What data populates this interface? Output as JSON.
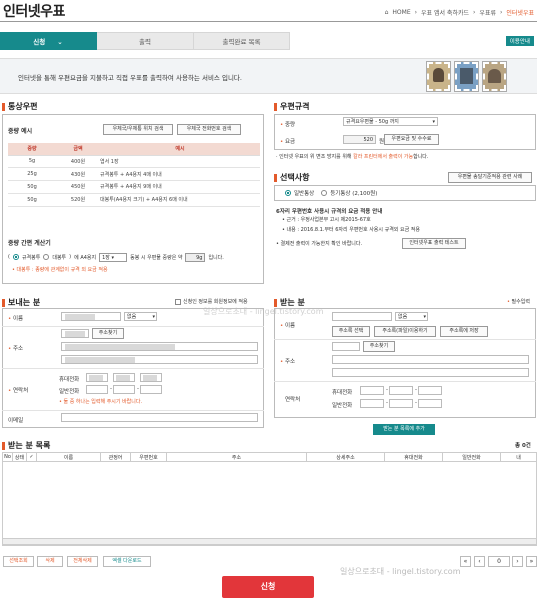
{
  "header": {
    "title": "인터넷우표",
    "breadcrumb": [
      "HOME",
      "우표 앱서 축하카드",
      "우표류",
      "인터넷우표"
    ]
  },
  "tabs": [
    {
      "label": "신청"
    },
    {
      "label": "출력"
    },
    {
      "label": "출력완료 목록"
    }
  ],
  "guide_button": "이용안내",
  "intro": "인터넷을 통해 우편요금을 지불하고 직접 우표를 출력하여 사용하는 서비스 입니다.",
  "postal": {
    "title": "통상우편",
    "example_label": "중량 예시",
    "btn_search_office": "우체국/우체통 위치 검색",
    "btn_search_zip": "우체국 전화번호 검색",
    "table": {
      "headers": [
        "중량",
        "금액",
        "예시"
      ],
      "rows": [
        {
          "weight": "5g",
          "price": "400원",
          "example": "엽서 1장"
        },
        {
          "weight": "25g",
          "price": "430원",
          "example": "규격봉투 + A4용지 4매 이내"
        },
        {
          "weight": "50g",
          "price": "450원",
          "example": "규격봉투 + A4용지 9매 이내"
        },
        {
          "weight": "50g",
          "price": "520원",
          "example": "대봉투(A4용지 크기) + A4용지 6매 이내"
        }
      ]
    },
    "calc_label": "중량 간편 계산기",
    "calc_opt1": "규격봉투",
    "calc_opt2": "대봉투",
    "calc_mid": "에 A4용지",
    "calc_qty": "1장",
    "calc_tail": "동봉 시 우편물 중량은 약",
    "calc_weight": "9g",
    "calc_unit": "입니다.",
    "calc_note": "• 대봉투 : 종량에 관계없이 규격 외 요금 적용"
  },
  "spec": {
    "title": "우편규격",
    "weight_label": "중량",
    "weight_value": "규격요우편물 - 50g 까지",
    "fee_label": "요금",
    "fee_value": "520",
    "fee_unit": "원",
    "fee_btn": "우편요금 및 수수료",
    "notice_a": "· 인터넷 우표의 위 변조 방지를 위해 ",
    "notice_b": "칼라 프린터에서 출력이 가능",
    "notice_c": "합니다."
  },
  "options": {
    "title": "선택사항",
    "btn": "우편물 송달기준적용 관련 사례",
    "opt1": "일반통상",
    "opt2": "등기통상 (2,100원)",
    "info_title": "6자리 우편번호 사용시 규격외 요금 적용 안내",
    "info1": "• 근거 : 우정사업본부 고시 제2015-67호",
    "info2": "• 내용 : 2016.8.1.부터 6자리 우편번호 사용시 규격외 요금 적용",
    "info3": "• 결제전 출력이 가능한지 확인 바랍니다.",
    "test_btn": "인터넷우표 출력 테스트"
  },
  "sender": {
    "title": "보내는 분",
    "checkbox": "신청인 정보를 회원정보에 적용",
    "name_label": "이름",
    "name_select": "없음",
    "addr_label": "주소",
    "addr_btn": "주소찾기",
    "contact_label": "연락처",
    "mobile_label": "휴대전화",
    "phone_label": "일반전화",
    "contact_note": "• 둘 중 하나는 입력해 주시기 바랍니다.",
    "email_label": "이메일"
  },
  "receiver": {
    "title": "받는 분",
    "required": "필수입력",
    "name_label": "이름",
    "name_select": "없음",
    "btn1": "주소록 선택",
    "btn2": "주소록(파일)이용하기",
    "btn3": "주소록에 저장",
    "addr_label": "주소",
    "addr_btn": "주소찾기",
    "contact_label": "연락처",
    "mobile_label": "휴대전화",
    "phone_label": "일반전화",
    "add_btn": "받는 분 목록에 추가"
  },
  "list": {
    "title": "받는 분 목록",
    "count": "총 0건",
    "headers": [
      "No",
      "상태",
      "",
      "이름",
      "관정어",
      "우편번호",
      "주소",
      "상세주소",
      "휴대전화",
      "일반전화",
      "내"
    ],
    "buttons": [
      "선택조회",
      "삭제",
      "전체삭제",
      "엑셀 다운로드"
    ],
    "page": "0"
  },
  "submit": "신청",
  "watermark": "일상으로초대 - lingel.tistory.com",
  "colors": {
    "teal": "#168a8c",
    "orange": "#e35a2b",
    "red": "#e2363a"
  }
}
